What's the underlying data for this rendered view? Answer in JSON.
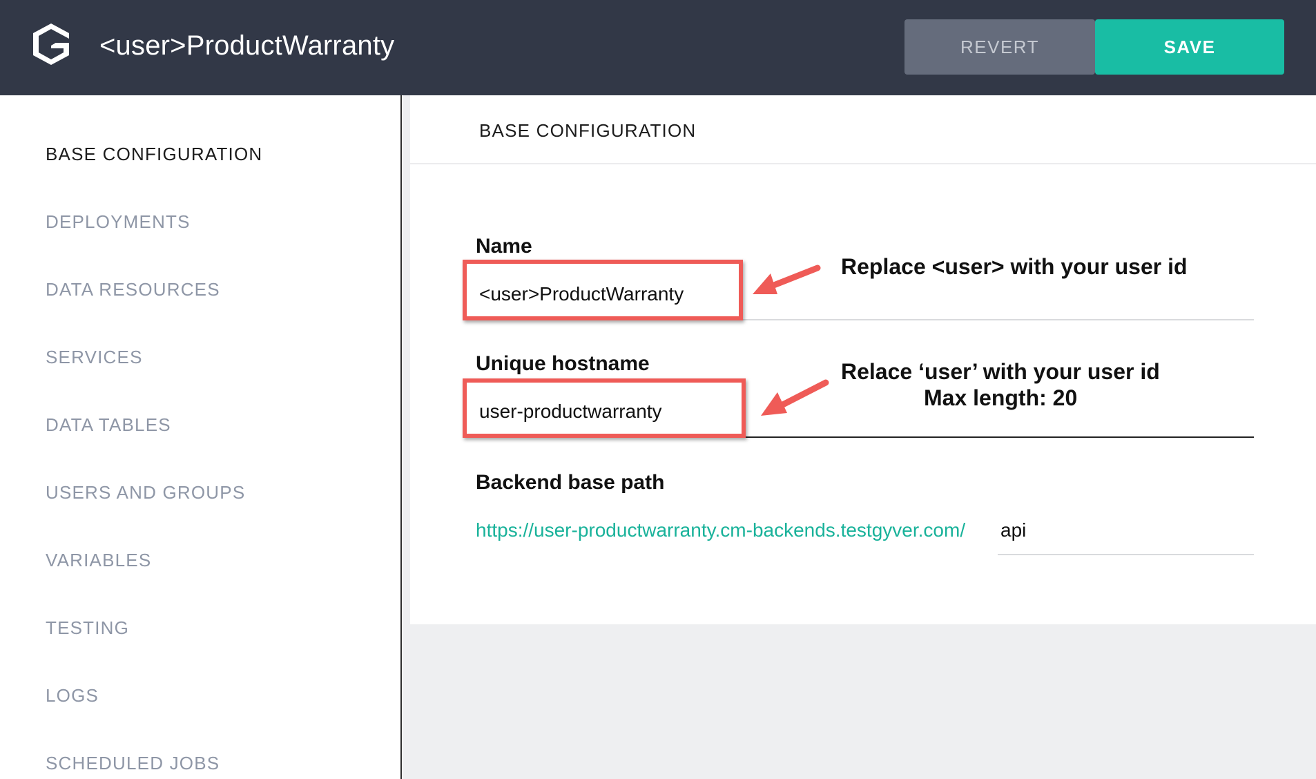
{
  "app": {
    "title": "<user>ProductWarranty",
    "logo_icon": "cloud-gateway-logo-icon"
  },
  "toolbar": {
    "revert_label": "REVERT",
    "save_label": "SAVE"
  },
  "colors": {
    "topbar": "#323847",
    "save": "#19bda4",
    "revert": "#656c7c",
    "annotation_red": "#ef5b57",
    "link_teal": "#19b29a"
  },
  "sidebar": {
    "items": [
      {
        "label": "BASE CONFIGURATION",
        "active": true
      },
      {
        "label": "DEPLOYMENTS",
        "active": false
      },
      {
        "label": "DATA RESOURCES",
        "active": false
      },
      {
        "label": "SERVICES",
        "active": false
      },
      {
        "label": "DATA TABLES",
        "active": false
      },
      {
        "label": "USERS AND GROUPS",
        "active": false
      },
      {
        "label": "VARIABLES",
        "active": false
      },
      {
        "label": "TESTING",
        "active": false
      },
      {
        "label": "LOGS",
        "active": false
      },
      {
        "label": "SCHEDULED JOBS",
        "active": false
      }
    ]
  },
  "main": {
    "section_title": "BASE CONFIGURATION",
    "fields": {
      "name": {
        "label": "Name",
        "value": "<user>ProductWarranty"
      },
      "hostname": {
        "label": "Unique hostname",
        "value": "user-productwarranty"
      },
      "backend": {
        "label": "Backend base path",
        "prefix": "https://user-productwarranty.cm-backends.testgyver.com/",
        "value": "api"
      }
    }
  },
  "annotations": {
    "name_note": "Replace <user> with your user id",
    "hostname_note_line1": "Relace ‘user’ with your user id",
    "hostname_note_line2": "Max length: 20"
  }
}
